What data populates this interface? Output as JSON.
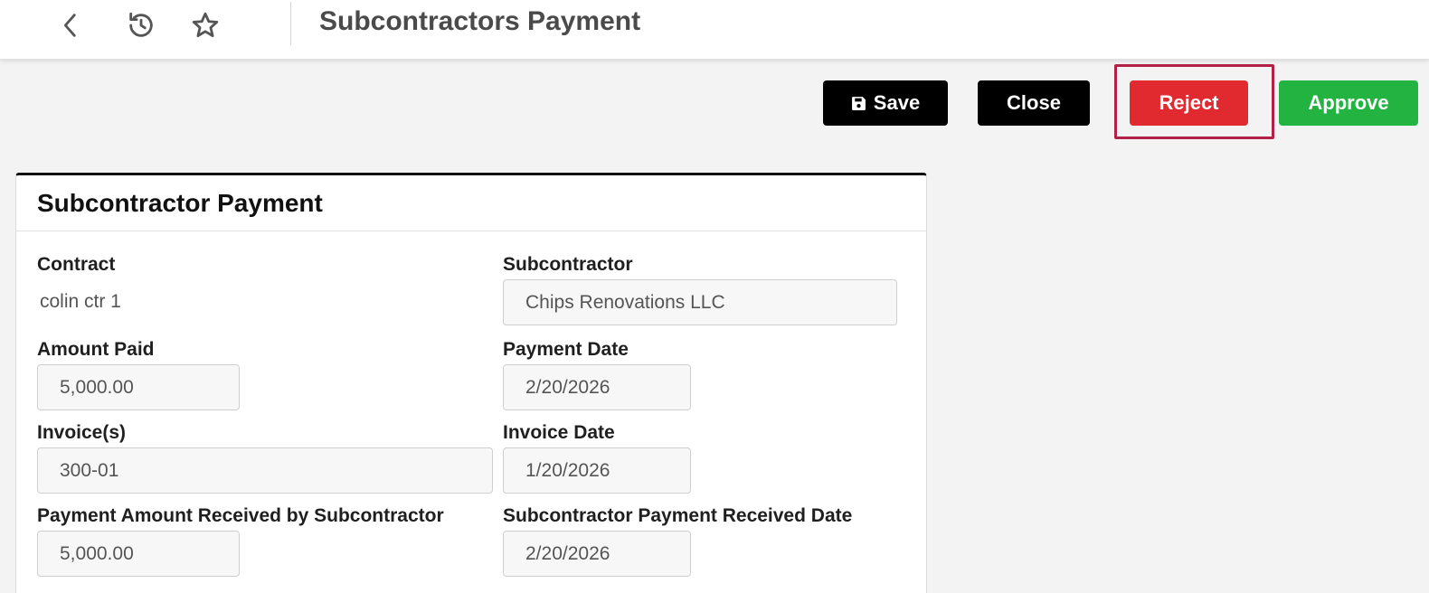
{
  "header": {
    "title": "Subcontractors Payment",
    "icons": [
      "back-icon",
      "history-icon",
      "star-icon"
    ]
  },
  "actions": {
    "save_label": "Save",
    "close_label": "Close",
    "reject_label": "Reject",
    "approve_label": "Approve"
  },
  "colors": {
    "reject": "#e02a2f",
    "approve": "#23b340",
    "primary": "#000000",
    "highlight": "#b22048"
  },
  "form": {
    "title": "Subcontractor Payment",
    "contract": {
      "label": "Contract",
      "value": "colin ctr 1"
    },
    "subcontractor": {
      "label": "Subcontractor",
      "value": "Chips Renovations LLC"
    },
    "amount_paid": {
      "label": "Amount Paid",
      "value": "5,000.00"
    },
    "payment_date": {
      "label": "Payment Date",
      "value": "2/20/2026"
    },
    "invoices": {
      "label": "Invoice(s)",
      "value": "300-01"
    },
    "invoice_date": {
      "label": "Invoice Date",
      "value": "1/20/2026"
    },
    "amount_received": {
      "label": "Payment Amount Received by Subcontractor",
      "value": "5,000.00"
    },
    "received_date": {
      "label": "Subcontractor Payment Received Date",
      "value": "2/20/2026"
    }
  }
}
